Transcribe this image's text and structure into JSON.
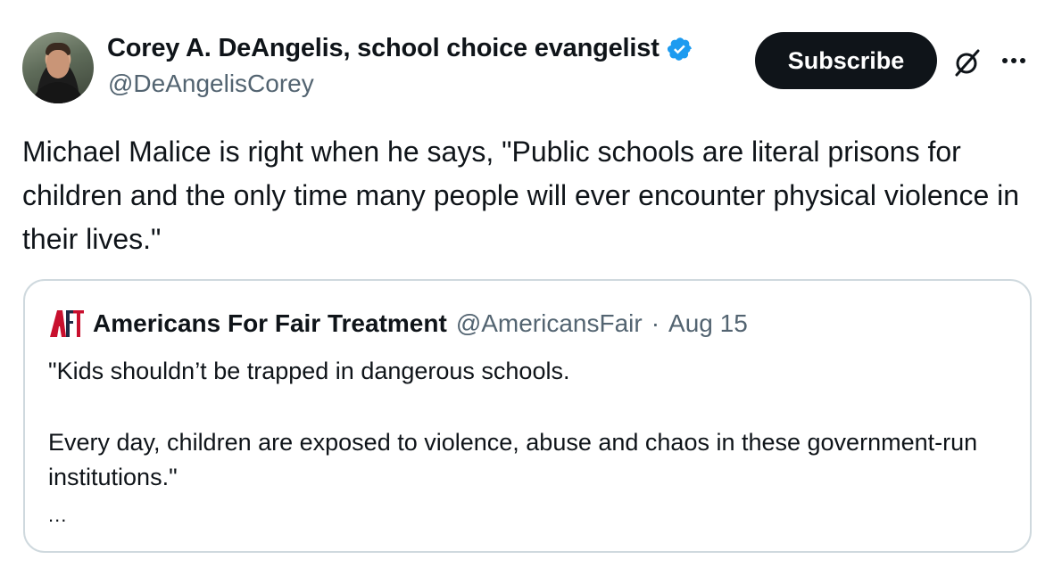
{
  "author": {
    "display_name": "Corey A. DeAngelis, school choice evangelist",
    "handle": "@DeAngelisCorey",
    "verified": true,
    "avatar_icon": "avatar-photo"
  },
  "actions": {
    "subscribe_label": "Subscribe",
    "grok_icon": "slashed-circle-icon",
    "more_icon": "more-dots-icon"
  },
  "tweet": {
    "text": "Michael Malice is right when he says, \"Public schools are literal prisons for children and the only time many people will ever encounter physical violence in their lives.\""
  },
  "quote": {
    "logo_icon": "aft-logo",
    "name": "Americans For Fair Treatment",
    "handle": "@AmericansFair",
    "separator": "·",
    "date": "Aug 15",
    "paragraph_1": "\"Kids shouldn’t be trapped in dangerous schools.",
    "paragraph_2": "Every day, children are exposed to violence, abuse and chaos in these government-run institutions.\"",
    "ellipsis": "..."
  },
  "colors": {
    "text_primary": "#0f1419",
    "text_secondary": "#536471",
    "verified_blue": "#1d9bf0",
    "border": "#cfd9de",
    "button_bg": "#0f1419",
    "logo_red": "#c8102e",
    "logo_navy": "#1f2a44"
  }
}
